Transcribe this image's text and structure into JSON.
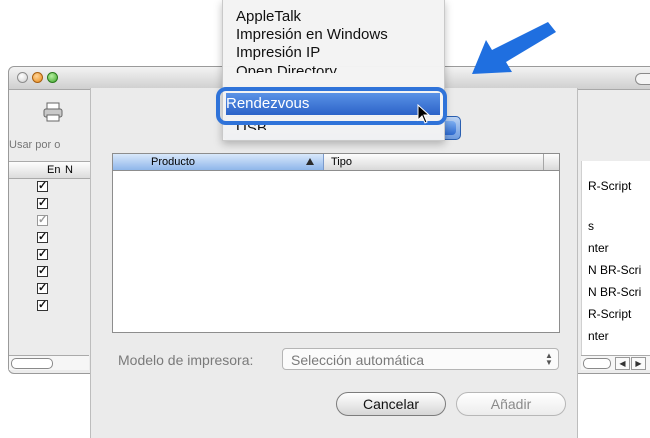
{
  "background_window": {
    "header_label": "Usar por o",
    "col_en": "En",
    "col_n": "N",
    "right_column": [
      "R-Script",
      "",
      "s",
      "nter",
      "N BR-Scri",
      "N BR-Scri",
      "R-Script",
      "nter"
    ],
    "scroll_left": "◀",
    "scroll_right": "▶"
  },
  "sheet": {
    "table": {
      "col_product": "Producto",
      "col_type": "Tipo"
    },
    "model_label": "Modelo de impresora:",
    "model_value": "Selección automática",
    "cancel_label": "Cancelar",
    "add_label": "Añadir"
  },
  "menu": {
    "items": [
      "AppleTalk",
      "Impresión en Windows",
      "Impresión IP",
      "Open Directory",
      "Rendezvous",
      "USB"
    ],
    "selected": "Rendezvous"
  },
  "colors": {
    "highlight": "#2f73d9",
    "arrow": "#1f6fe0"
  }
}
